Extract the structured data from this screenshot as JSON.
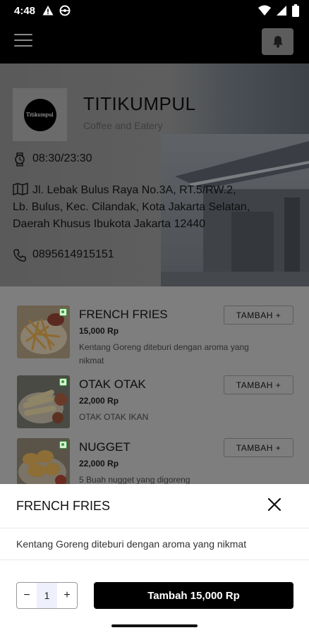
{
  "status_bar": {
    "time": "4:48",
    "icons": [
      "alert-icon",
      "steering-wheel-icon",
      "wifi-icon",
      "signal-icon",
      "battery-icon"
    ]
  },
  "app_bar": {
    "menu_icon": "hamburger-icon",
    "bell_icon": "bell-icon"
  },
  "shop": {
    "logo_text": "Titikumpul",
    "name": "TITIKUMPUL",
    "subtitle": "Coffee and Eatery",
    "hours": "08:30/23:30",
    "address": "Jl. Lebak Bulus Raya No.3A, RT.5/RW.2, Lb. Bulus, Kec. Cilandak, Kota Jakarta Selatan, Daerah Khusus Ibukota Jakarta 12440",
    "phone": "0895614915151"
  },
  "menu": {
    "items": [
      {
        "name": "FRENCH FRIES",
        "price": "15,000 Rp",
        "desc": "Kentang Goreng diteburi dengan aroma yang nikmat",
        "button": "TAMBAH +"
      },
      {
        "name": "OTAK OTAK",
        "price": "22,000 Rp",
        "desc": "OTAK OTAK IKAN",
        "button": "TAMBAH +"
      },
      {
        "name": "NUGGET",
        "price": "22,000 Rp",
        "desc": "5 Buah nugget yang digoreng",
        "button": "TAMBAH +"
      }
    ]
  },
  "sheet": {
    "title": "FRENCH FRIES",
    "desc": "Kentang Goreng diteburi dengan aroma yang nikmat",
    "minus": "−",
    "qty": "1",
    "plus": "+",
    "submit": "Tambah 15,000 Rp"
  },
  "colors": {
    "overlay": "#7e7e7e",
    "accent": "#000000",
    "veg_badge": "#3a9a3a"
  }
}
